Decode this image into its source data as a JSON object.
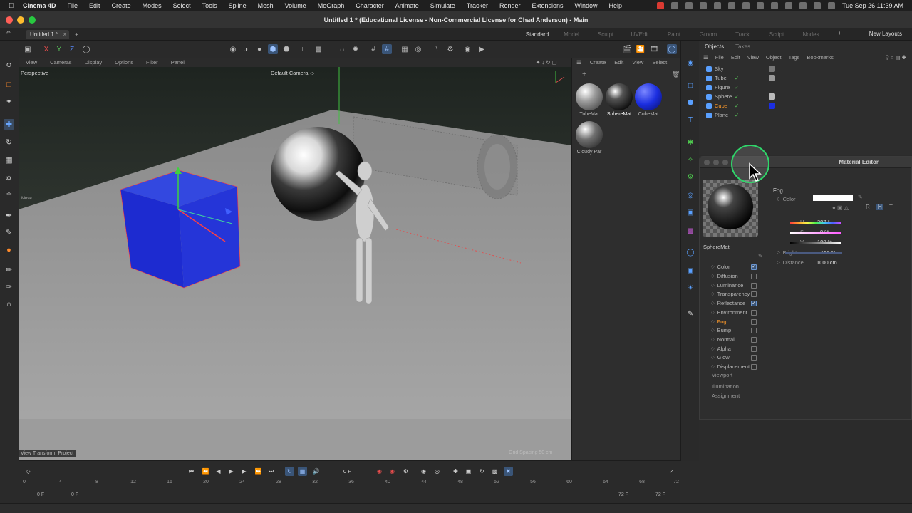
{
  "menubar": {
    "app_name": "Cinema 4D",
    "items": [
      "File",
      "Edit",
      "Create",
      "Modes",
      "Select",
      "Tools",
      "Spline",
      "Mesh",
      "Volume",
      "MoGraph",
      "Character",
      "Animate",
      "Simulate",
      "Tracker",
      "Render",
      "Extensions",
      "Window",
      "Help"
    ],
    "datetime": "Tue Sep 26  11:39 AM"
  },
  "window": {
    "title": "Untitled 1 * (Educational License - Non-Commercial License for Chad Anderson) - Main",
    "tab": "Untitled 1 *",
    "layouts": [
      "Standard",
      "Model",
      "Sculpt",
      "UVEdit",
      "Paint",
      "Groom",
      "Track",
      "Script",
      "Nodes"
    ],
    "active_layout": "Standard",
    "new_layouts": "New Layouts"
  },
  "viewport": {
    "menu": [
      "View",
      "Cameras",
      "Display",
      "Options",
      "Filter",
      "Panel"
    ],
    "label": "Perspective",
    "camera": "Default Camera ·:·",
    "view_transform": "View Transform: Project",
    "grid_spacing": "Grid Spacing   50 cm",
    "move_label": "Move"
  },
  "materials": {
    "menu": [
      "Create",
      "Edit",
      "View",
      "Select"
    ],
    "items": [
      {
        "name": "TubeMat",
        "color": "#9a9a9a"
      },
      {
        "name": "SphereMat",
        "color": "#111111"
      },
      {
        "name": "CubeMat",
        "color": "#1b2ee0"
      },
      {
        "name": "Cloudy Par",
        "color": "#707070"
      }
    ],
    "selected": "SphereMat"
  },
  "objects": {
    "tabs": [
      "Objects",
      "Takes"
    ],
    "menu": [
      "File",
      "Edit",
      "View",
      "Object",
      "Tags",
      "Bookmarks"
    ],
    "rows": [
      {
        "name": "Sky",
        "icon_color": "#5aa0ff"
      },
      {
        "name": "Tube",
        "icon_color": "#5aa0ff"
      },
      {
        "name": "Figure",
        "icon_color": "#5aa0ff"
      },
      {
        "name": "Sphere",
        "icon_color": "#5aa0ff"
      },
      {
        "name": "Cube",
        "icon_color": "#5aa0ff"
      },
      {
        "name": "Plane",
        "icon_color": "#5aa0ff"
      }
    ],
    "selected": "Cube"
  },
  "material_editor": {
    "title": "Material Editor",
    "material_name": "SphereMat",
    "channels": [
      {
        "name": "Color",
        "checked": true
      },
      {
        "name": "Diffusion",
        "checked": false
      },
      {
        "name": "Luminance",
        "checked": false
      },
      {
        "name": "Transparency",
        "checked": false
      },
      {
        "name": "Reflectance",
        "checked": true
      },
      {
        "name": "Environment",
        "checked": false
      },
      {
        "name": "Fog",
        "checked": false
      },
      {
        "name": "Bump",
        "checked": false
      },
      {
        "name": "Normal",
        "checked": false
      },
      {
        "name": "Alpha",
        "checked": false
      },
      {
        "name": "Glow",
        "checked": false
      },
      {
        "name": "Displacement",
        "checked": false
      }
    ],
    "active_channel": "Fog",
    "extra_items": [
      "Viewport",
      "Illumination",
      "Assignment"
    ],
    "section": "Fog",
    "color_label": "Color",
    "color_value": "#ffffff",
    "color_modes": [
      "R",
      "H",
      "T"
    ],
    "h_label": "H",
    "h_value": "307 °",
    "s_label": "S",
    "s_value": "0 %",
    "v_label": "V",
    "v_value": "100 %",
    "brightness_label": "Brightness",
    "brightness_value": "100 %",
    "distance_label": "Distance",
    "distance_value": "1000 cm"
  },
  "timeline": {
    "current_frame": "0 F",
    "ticks": [
      "0",
      "4",
      "8",
      "12",
      "16",
      "20",
      "24",
      "28",
      "32",
      "36",
      "40",
      "44",
      "48",
      "52",
      "56",
      "60",
      "64",
      "68",
      "72"
    ],
    "range_start": "0 F",
    "range_start2": "0 F",
    "range_end": "72 F",
    "range_end2": "72 F"
  }
}
